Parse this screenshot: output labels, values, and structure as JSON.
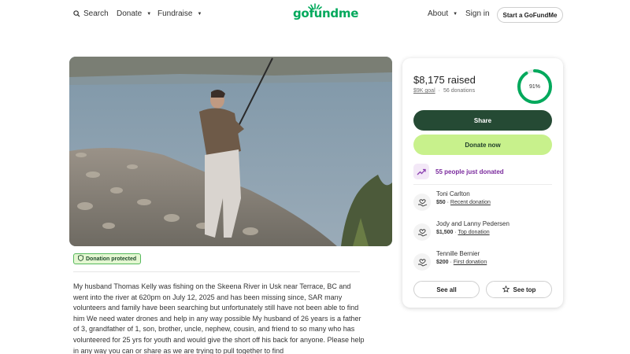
{
  "header": {
    "search_label": "Search",
    "donate_label": "Donate",
    "fundraise_label": "Fundraise",
    "logo_text": "gofundme",
    "about_label": "About",
    "signin_label": "Sign in",
    "start_label": "Start a GoFundMe"
  },
  "campaign": {
    "protected_badge": "Donation protected",
    "story": "My husband Thomas Kelly was fishing on the Skeena River in Usk near Terrace, BC and went into the river at 620pm on July 12, 2025 and has been missing since, SAR many volunteers and family have been searching but unfortunately still have not been able to find him We need water drones and help in any way possible My husband of 26 years is a father of 3, grandfather of 1, son, brother, uncle, nephew, cousin, and friend to so many who has volunteered for 25 yrs for youth and would give the short off his back for anyone. Please help in any way you can or share as we are trying to pull together to find"
  },
  "donation_card": {
    "raised": "$8,175",
    "raised_suffix": "raised",
    "goal": "$9K goal",
    "separator": "·",
    "donations": "56 donations",
    "percent_label": "91%",
    "percent_value": 0.91,
    "share_label": "Share",
    "donate_label": "Donate now",
    "recent_activity": "55 people just donated",
    "donors": [
      {
        "name": "Toni Carlton",
        "amount": "$50",
        "tag": "Recent donation"
      },
      {
        "name": "Jody and Lanny Pedersen",
        "amount": "$1,500",
        "tag": "Top donation"
      },
      {
        "name": "Tennille Bernier",
        "amount": "$200",
        "tag": "First donation"
      }
    ],
    "see_all_label": "See all",
    "see_top_label": "See top"
  },
  "colors": {
    "brand_green": "#02a95c",
    "share_bg": "#254a34",
    "donate_bg": "#c8f18c",
    "activity_purple": "#7a2a9d",
    "badge_bg": "#e4f7d2"
  },
  "icons": {
    "search": "search-icon",
    "caret": "chevron-down-icon",
    "shield": "shield-icon",
    "trend": "trending-up-icon",
    "donor": "heart-hand-icon",
    "star": "star-icon"
  }
}
